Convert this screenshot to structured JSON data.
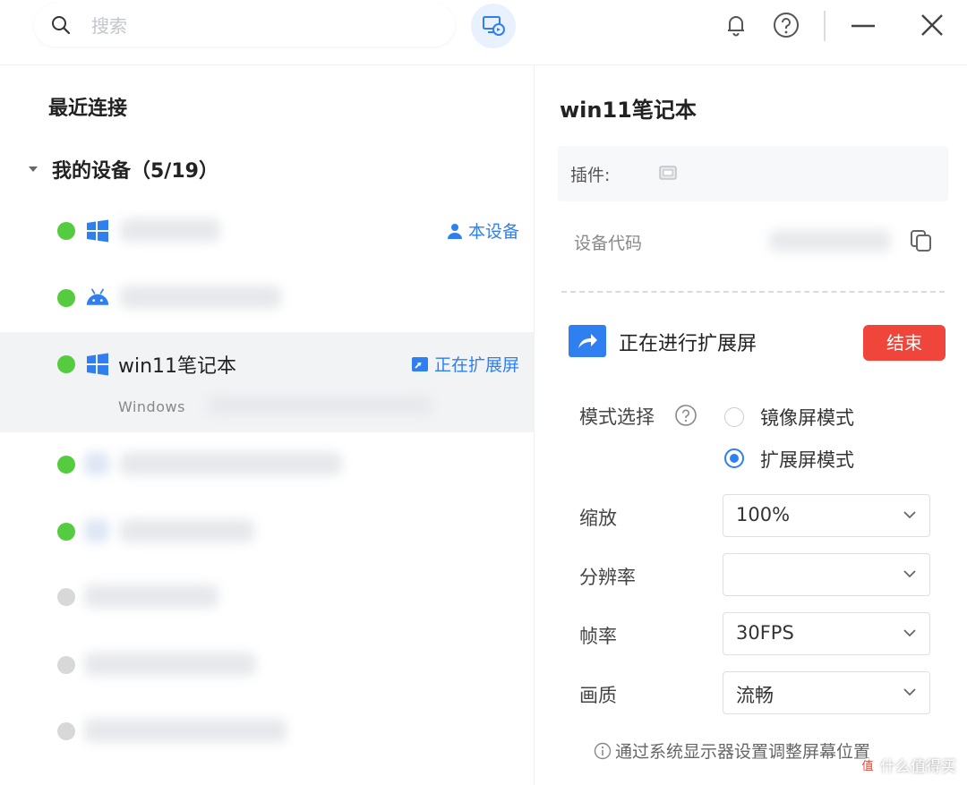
{
  "search": {
    "placeholder": "搜索"
  },
  "sidebar": {
    "recent_label": "最近连接",
    "my_devices_label": "我的设备（5/19）",
    "devices": [
      {
        "os": "windows",
        "online": true,
        "tag": "本设备"
      },
      {
        "os": "android",
        "online": true
      },
      {
        "os": "windows",
        "online": true,
        "name": "win11笔记本",
        "sub": "Windows",
        "tag": "正在扩展屏",
        "selected": true
      },
      {
        "os": "other",
        "online": true
      },
      {
        "os": "other",
        "online": true
      },
      {
        "os": "other",
        "online": false
      },
      {
        "os": "other",
        "online": false
      },
      {
        "os": "other",
        "online": false
      }
    ]
  },
  "detail": {
    "title": "win11笔记本",
    "plugin_label": "插件:",
    "device_code_label": "设备代码",
    "extend_status": "正在进行扩展屏",
    "end_label": "结束",
    "mode_label": "模式选择",
    "mode_options": [
      "镜像屏模式",
      "扩展屏模式"
    ],
    "mode_selected": "扩展屏模式",
    "scale_label": "缩放",
    "scale_value": "100%",
    "resolution_label": "分辨率",
    "resolution_value": "",
    "framerate_label": "帧率",
    "framerate_value": "30FPS",
    "quality_label": "画质",
    "quality_value": "流畅",
    "tip": "通过系统显示器设置调整屏幕位置"
  },
  "watermark": {
    "icon_text": "值",
    "text": "什么值得买"
  },
  "colors": {
    "accent": "#2f7ff0",
    "online": "#55cc3f",
    "offline": "#d8d8d8",
    "danger": "#f0453a"
  }
}
